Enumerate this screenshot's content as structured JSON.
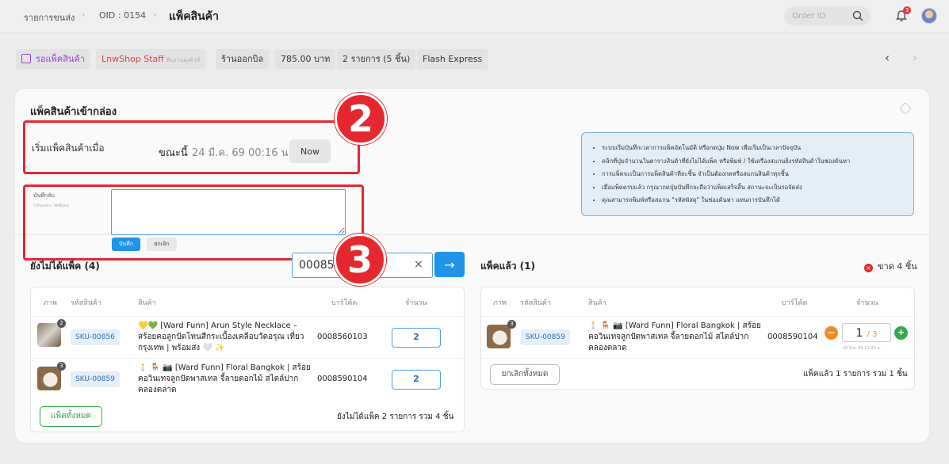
{
  "topbar": {
    "breadcrumb_1": "รายการขนส่ง",
    "breadcrumb_2": "OID : 0154",
    "page_title": "แพ็คสินค้า",
    "search_placeholder": "Order ID",
    "notification_count": "3"
  },
  "status": {
    "state": "รอแพ็คสินค้า",
    "staff": "LnwShop Staff",
    "staff_note": "ทีมงานลุงคิวท์",
    "bill_status": "ร้านออกบิล",
    "amount": "785.00 บาท",
    "items": "2 รายการ (5 ชิ้น)",
    "carrier": "Flash Express"
  },
  "pack": {
    "title": "แพ็คสินค้าเข้ากล่อง",
    "start_label": "เริ่มแพ็คสินค้าเมื่อ",
    "now_prefix": "ขณะนี้",
    "now_time": "24 มี.ค. 69 00:16 น.",
    "now_button": "Now",
    "note_label": "บันทึกลับ",
    "note_sub": "(เห็นเฉพาะ สิทธิ์คุณ)",
    "save_button": "บันทึก",
    "cancel_button": "ยกเลิก",
    "callouts": [
      "2",
      "3"
    ]
  },
  "info": [
    "ระบบเริ่มบันทึกเวลาการแพ็คอัตโนมัติ หรือกดปุ่ม Now เพื่อเริ่มเป็นเวลาปัจจุบัน",
    "คลิกที่ปุ่มจำนวนในตารางสินค้าที่ยังไม่ได้แพ็ค หรือพิมพ์ / ใช้เครื่องสแกนยิงรหัสสินค้าในช่องค้นหา",
    "การแพ็คจะเป็นการแพ็คสินค้าทีละชิ้น จำเป็นต้องกดหรือสแกนสินค้าทุกชิ้น",
    "เมื่อแพ็คครบแล้ว กรุณากดปุ่มบันทึกจะถือว่าแพ็คเสร็จสิ้น สถานะจะเป็นรอจัดส่ง",
    "คุณสามารถพิมพ์หรือสแกน \"รหัสพัสดุ\" ในช่องค้นหา แทนการบันทึกได้"
  ],
  "scan": {
    "left_heading": "ยังไม่ได้แพ็ค (4)",
    "input_value": "000859",
    "clear": "×",
    "go": "→",
    "right_heading": "แพ็คแล้ว (1)",
    "missing": "ขาด 4 ชิ้น"
  },
  "headers": {
    "image": "ภาพ",
    "sku": "รหัสสินค้า",
    "product": "สินค้า",
    "barcode": "บาร์โค้ด",
    "qty": "จำนวน"
  },
  "unpacked": {
    "rows": [
      {
        "badge": "2",
        "sku": "SKU-00856",
        "name_1": "💛💚 [Ward Funn] Arun Style Necklace –",
        "name_2": "สร้อยคอลูกปัดโทนสีกระเบื้องเคลือบวัดอรุณ เที่ยว",
        "name_3": "กรุงเทพ | พร้อมส่ง 🤍 ✨",
        "barcode": "0008560103",
        "qty": "2"
      },
      {
        "badge": "3",
        "sku": "SKU-00859",
        "name_1": "🕯️ 🪑 📷 [Ward Funn] Floral Bangkok | สร้อย",
        "name_2": "คอวินเทจลูกปัดพาสเทล จี้ลายดอกไม้ สไตล์ปาก",
        "name_3": "คลองตลาด",
        "barcode": "0008590104",
        "qty": "2"
      }
    ],
    "pack_all": "แพ็คทั้งหมด",
    "summary": "ยังไม่ได้แพ็ค 2 รายการ รวม 4 ชิ้น"
  },
  "packed": {
    "rows": [
      {
        "badge": "3",
        "sku": "SKU-00859",
        "name_1": "🕯️ 🪑 📷 [Ward Funn] Floral Bangkok | สร้อย",
        "name_2": "คอวินเทจลูกปัดพาสเทล จี้ลายดอกไม้ สไตล์ปาก",
        "name_3": "คลองตลาด",
        "barcode": "0008590104",
        "packed": "1",
        "total": "/ 3",
        "time": "26 มี.ค. 69 11:03 น."
      }
    ],
    "cancel_all": "ยกเลิกทั้งหมด",
    "summary": "แพ็คแล้ว 1 รายการ รวม 1 ชิ้น"
  },
  "colors": {
    "accent": "#1f94e8",
    "callout_red": "#e5282f",
    "success": "#35a84a",
    "warning": "#f28a22",
    "state_purple": "#9b3fd8"
  }
}
